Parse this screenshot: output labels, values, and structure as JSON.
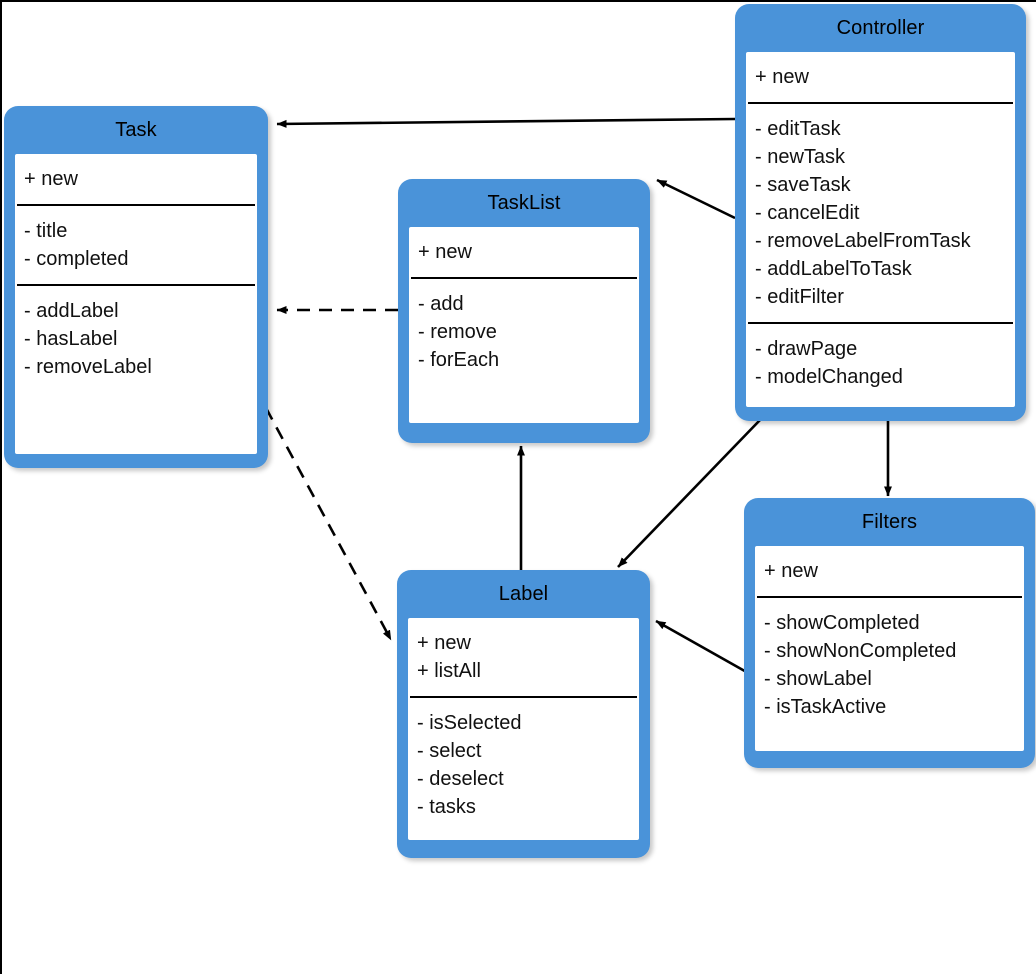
{
  "diagram": {
    "kind": "uml-class-diagram",
    "colors": {
      "class_fill": "#4a93d9",
      "compartment_fill": "#ffffff",
      "line": "#000000",
      "canvas": "#ffffff"
    },
    "classes": [
      {
        "id": "task",
        "name": "Task",
        "compartments": [
          {
            "members": [
              "+ new"
            ]
          },
          {
            "members": [
              "- title",
              "- completed"
            ]
          },
          {
            "members": [
              "- addLabel",
              "- hasLabel",
              "- removeLabel"
            ]
          }
        ]
      },
      {
        "id": "tasklist",
        "name": "TaskList",
        "compartments": [
          {
            "members": [
              "+ new"
            ]
          },
          {
            "members": [
              "- add",
              "- remove",
              "- forEach"
            ]
          }
        ]
      },
      {
        "id": "controller",
        "name": "Controller",
        "compartments": [
          {
            "members": [
              "+ new"
            ]
          },
          {
            "members": [
              "- editTask",
              "- newTask",
              "- saveTask",
              "- cancelEdit",
              "- removeLabelFromTask",
              "- addLabelToTask",
              "- editFilter"
            ]
          },
          {
            "members": [
              "- drawPage",
              "- modelChanged"
            ]
          }
        ]
      },
      {
        "id": "label",
        "name": "Label",
        "compartments": [
          {
            "members": [
              "+ new",
              "+ listAll"
            ]
          },
          {
            "members": [
              "- isSelected",
              "- select",
              "- deselect",
              "- tasks"
            ]
          }
        ]
      },
      {
        "id": "filters",
        "name": "Filters",
        "compartments": [
          {
            "members": [
              "+ new"
            ]
          },
          {
            "members": [
              "- showCompleted",
              "- showNonCompleted",
              "- showLabel",
              "- isTaskActive"
            ]
          }
        ]
      }
    ],
    "connections": [
      {
        "id": "controller-to-task",
        "from": "controller",
        "to": "task",
        "style": "solid",
        "arrow": "open-filled"
      },
      {
        "id": "controller-to-tasklist",
        "from": "controller",
        "to": "tasklist",
        "style": "solid",
        "arrow": "open-filled"
      },
      {
        "id": "controller-to-label",
        "from": "controller",
        "to": "label",
        "style": "solid",
        "arrow": "open-filled"
      },
      {
        "id": "controller-to-filters",
        "from": "controller",
        "to": "filters",
        "style": "solid",
        "arrow": "open-filled"
      },
      {
        "id": "tasklist-to-task",
        "from": "tasklist",
        "to": "task",
        "style": "dashed",
        "arrow": "open-filled"
      },
      {
        "id": "task-to-label",
        "from": "task",
        "to": "label",
        "style": "dashed",
        "arrow": "open-filled"
      },
      {
        "id": "label-to-tasklist",
        "from": "label",
        "to": "tasklist",
        "style": "solid",
        "arrow": "open-filled"
      },
      {
        "id": "filters-to-label",
        "from": "filters",
        "to": "label",
        "style": "solid",
        "arrow": "open-filled"
      }
    ]
  }
}
